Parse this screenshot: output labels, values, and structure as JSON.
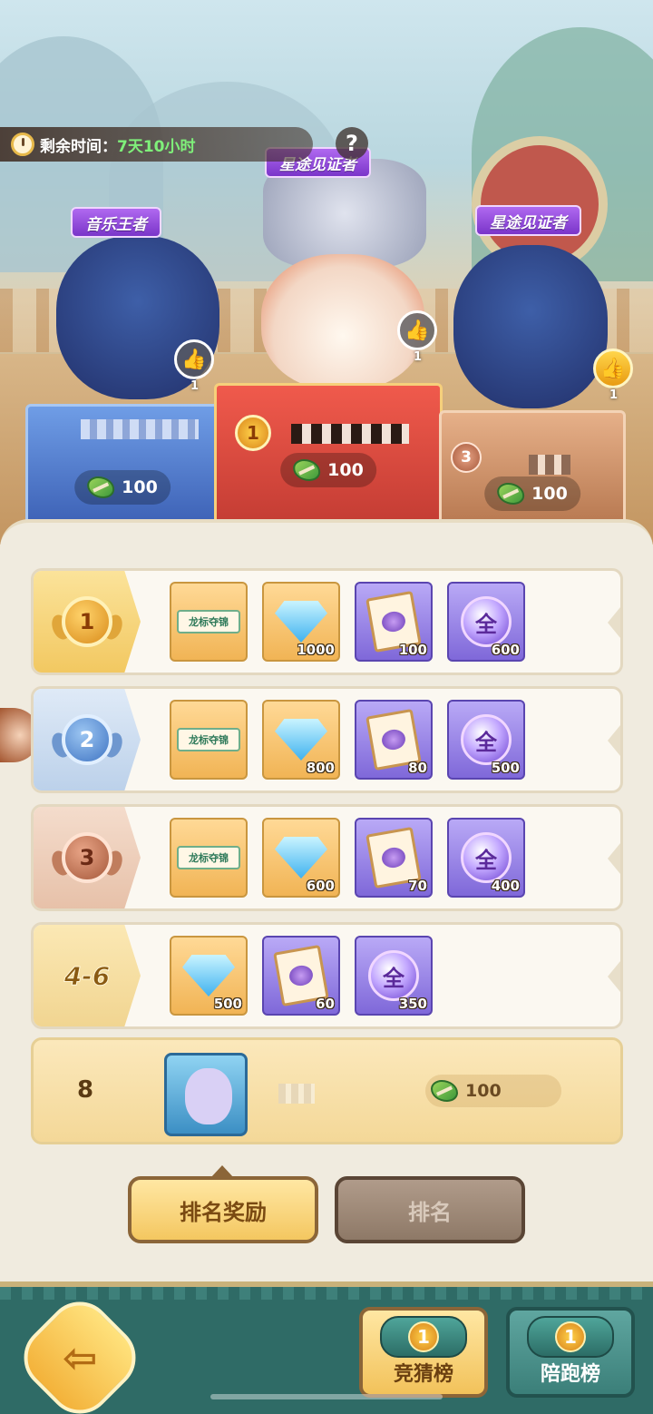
{
  "header": {
    "timer_label": "剩余时间：",
    "timer_value": "7天10小时",
    "help_symbol": "?"
  },
  "podium": {
    "first": {
      "rank": "1",
      "title": "星途见证者",
      "score": "100",
      "likes": "1"
    },
    "second": {
      "title": "音乐王者",
      "score": "100",
      "likes": "1"
    },
    "third": {
      "rank": "3",
      "title": "星途见证者",
      "score": "100",
      "likes": "1"
    }
  },
  "rewards": [
    {
      "rank": "1",
      "items": [
        {
          "icon": "dragon-boat-banner",
          "label": "龙标夺锦",
          "qty": ""
        },
        {
          "icon": "diamond",
          "qty": "1000"
        },
        {
          "icon": "integral-scroll",
          "qty": "100"
        },
        {
          "icon": "quan-orb",
          "label": "全",
          "qty": "600"
        }
      ]
    },
    {
      "rank": "2",
      "items": [
        {
          "icon": "dragon-boat-banner",
          "label": "龙标夺锦",
          "qty": ""
        },
        {
          "icon": "diamond",
          "qty": "800"
        },
        {
          "icon": "integral-scroll",
          "qty": "80"
        },
        {
          "icon": "quan-orb",
          "label": "全",
          "qty": "500"
        }
      ]
    },
    {
      "rank": "3",
      "items": [
        {
          "icon": "dragon-boat-banner",
          "label": "龙标夺锦",
          "qty": ""
        },
        {
          "icon": "diamond",
          "qty": "600"
        },
        {
          "icon": "integral-scroll",
          "qty": "70"
        },
        {
          "icon": "quan-orb",
          "label": "全",
          "qty": "400"
        }
      ]
    },
    {
      "rank": "4-6",
      "items": [
        {
          "icon": "diamond",
          "qty": "500"
        },
        {
          "icon": "integral-scroll",
          "qty": "60"
        },
        {
          "icon": "quan-orb",
          "label": "全",
          "qty": "350"
        }
      ]
    }
  ],
  "my_rank": {
    "rank": "8",
    "score": "100"
  },
  "tabs": {
    "reward_tab": "排名奖励",
    "rank_tab": "排名"
  },
  "bottom_nav": {
    "guess_board": "竞猜榜",
    "guess_badge": "1",
    "run_board": "陪跑榜",
    "run_badge": "1"
  },
  "colors": {
    "accent_gold": "#f4c760",
    "bar_teal": "#2f6b66",
    "title_purple": "#7a35c9"
  }
}
